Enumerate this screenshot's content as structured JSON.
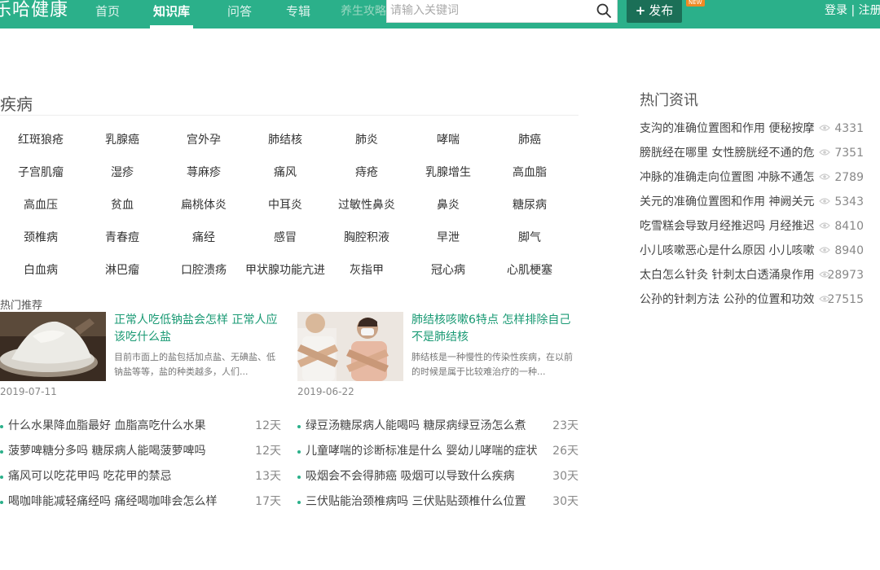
{
  "header": {
    "logo": "乐哈健康",
    "nav": [
      "首页",
      "知识库",
      "问答",
      "专辑",
      "养生攻略"
    ],
    "search_placeholder": "请输入关键词",
    "publish_label": "发布",
    "new_badge": "NEW",
    "login": "登录",
    "separator": "|",
    "register": "注册"
  },
  "disease": {
    "title": "疾病",
    "rows": [
      [
        "红斑狼疮",
        "乳腺癌",
        "宫外孕",
        "肺结核",
        "肺炎",
        "哮喘",
        "肺癌"
      ],
      [
        "子宫肌瘤",
        "湿疹",
        "荨麻疹",
        "痛风",
        "痔疮",
        "乳腺增生",
        "高血脂"
      ],
      [
        "高血压",
        "贫血",
        "扁桃体炎",
        "中耳炎",
        "过敏性鼻炎",
        "鼻炎",
        "糖尿病"
      ],
      [
        "颈椎病",
        "青春痘",
        "痛经",
        "感冒",
        "胸腔积液",
        "早泄",
        "脚气"
      ],
      [
        "白血病",
        "淋巴瘤",
        "口腔溃疡",
        "甲状腺功能亢进",
        "灰指甲",
        "冠心病",
        "心肌梗塞"
      ]
    ]
  },
  "recommend": {
    "label": "热门推荐",
    "cards": [
      {
        "title": "正常人吃低钠盐会怎样 正常人应该吃什么盐",
        "desc": "目前市面上的盐包括加点盐、无碘盐、低钠盐等等，盐的种类越多，人们...",
        "date": "2019-07-11"
      },
      {
        "title": "肺结核咳嗽6特点 怎样排除自己不是肺结核",
        "desc": "肺结核是一种慢性的传染性疾病，在以前的时候是属于比较难治疗的一种...",
        "date": "2019-06-22"
      }
    ]
  },
  "lists": {
    "left": [
      {
        "text": "什么水果降血脂最好 血脂高吃什么水果",
        "days": "12天"
      },
      {
        "text": "菠萝啤糖分多吗 糖尿病人能喝菠萝啤吗",
        "days": "12天"
      },
      {
        "text": "痛风可以吃花甲吗 吃花甲的禁忌",
        "days": "13天"
      },
      {
        "text": "喝咖啡能减轻痛经吗 痛经喝咖啡会怎么样",
        "days": "17天"
      }
    ],
    "right": [
      {
        "text": "绿豆汤糖尿病人能喝吗 糖尿病绿豆汤怎么煮",
        "days": "23天"
      },
      {
        "text": "儿童哮喘的诊断标准是什么 婴幼儿哮喘的症状",
        "days": "26天"
      },
      {
        "text": "吸烟会不会得肺癌 吸烟可以导致什么疾病",
        "days": "30天"
      },
      {
        "text": "三伏贴能治颈椎病吗 三伏贴贴颈椎什么位置",
        "days": "30天"
      }
    ]
  },
  "hot": {
    "title": "热门资讯",
    "items": [
      {
        "text": "支沟的准确位置图和作用 便秘按摩",
        "views": "4331"
      },
      {
        "text": "膀胱经在哪里 女性膀胱经不通的危",
        "views": "7351"
      },
      {
        "text": "冲脉的准确走向位置图 冲脉不通怎",
        "views": "2789"
      },
      {
        "text": "关元的准确位置图和作用 神阙关元",
        "views": "5343"
      },
      {
        "text": "吃雪糕会导致月经推迟吗 月经推迟",
        "views": "8410"
      },
      {
        "text": "小儿咳嗽恶心是什么原因 小儿咳嗽",
        "views": "8940"
      },
      {
        "text": "太白怎么针灸 针刺太白透涌泉作用",
        "views": "28973"
      },
      {
        "text": "公孙的针刺方法 公孙的位置和功效",
        "views": "27515"
      }
    ]
  },
  "colors": {
    "brand": "#2bb08a",
    "publish": "#1b6f57",
    "link": "#1a9a74",
    "badge": "#f08a24"
  },
  "icons": [
    "search-icon",
    "plus-icon",
    "eye-icon"
  ]
}
